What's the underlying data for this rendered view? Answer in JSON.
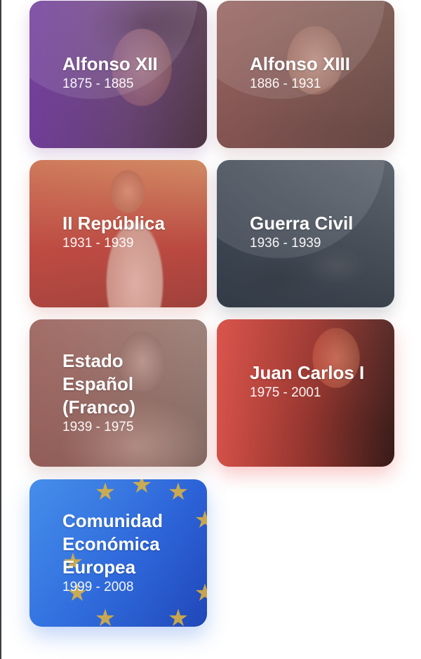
{
  "cards": [
    {
      "title": "Alfonso XII",
      "years": "1875 - 1885"
    },
    {
      "title": "Alfonso XIII",
      "years": "1886 - 1931"
    },
    {
      "title": "II República",
      "years": "1931 - 1939"
    },
    {
      "title": "Guerra Civil",
      "years": "1936 - 1939"
    },
    {
      "title": "Estado Español (Franco)",
      "years": "1939 - 1975"
    },
    {
      "title": "Juan Carlos I",
      "years": "1975 - 2001"
    },
    {
      "title": "Comunidad Económica Europea",
      "years": "1999 - 2008"
    }
  ],
  "icons": {
    "eu_star": "★"
  },
  "colors": {
    "alfonso_xii_tint": "#763ea8",
    "juan_carlos_tint": "#f05a50",
    "eu_blue": "#2c62d6",
    "eu_star": "#e3b53a"
  }
}
